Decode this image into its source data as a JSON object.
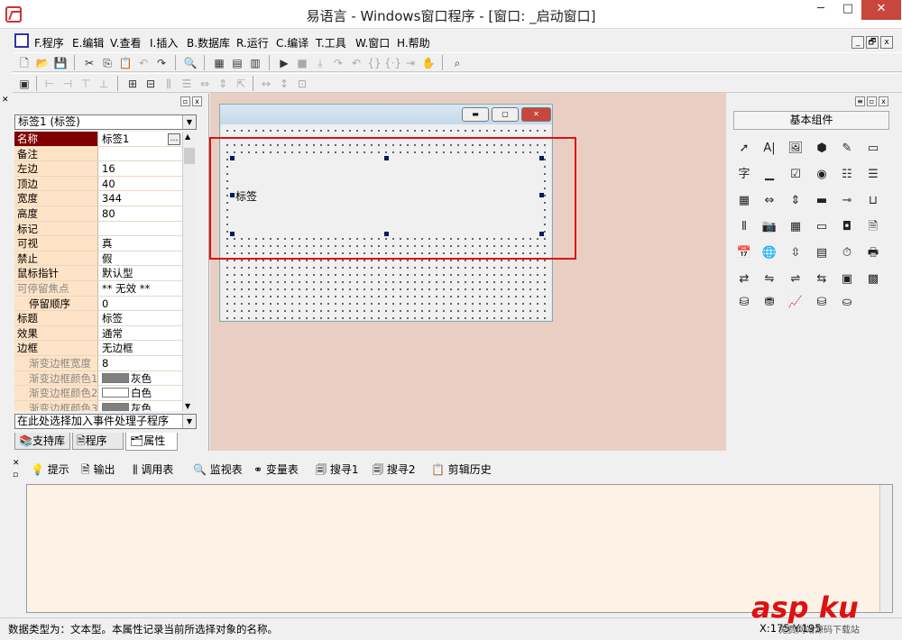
{
  "window": {
    "title": "易语言 - Windows窗口程序 - [窗口: _启动窗口]",
    "min": "─",
    "max": "□",
    "close": "✕"
  },
  "menu": {
    "items": [
      "F.程序",
      "E.编辑",
      "V.查看",
      "I.插入",
      "B.数据库",
      "R.运行",
      "C.编译",
      "T.工具",
      "W.窗口",
      "H.帮助"
    ],
    "mdi": [
      "_",
      "🗗",
      "x"
    ]
  },
  "left_panel": {
    "object_select": "标签1 (标签)",
    "properties": [
      {
        "name": "名称",
        "value": "标签1",
        "selected": true
      },
      {
        "name": "备注",
        "value": ""
      },
      {
        "name": "左边",
        "value": "16"
      },
      {
        "name": "顶边",
        "value": "40"
      },
      {
        "name": "宽度",
        "value": "344"
      },
      {
        "name": "高度",
        "value": "80"
      },
      {
        "name": "标记",
        "value": ""
      },
      {
        "name": "可视",
        "value": "真"
      },
      {
        "name": "禁止",
        "value": "假"
      },
      {
        "name": "鼠标指针",
        "value": "默认型"
      },
      {
        "name": "可停留焦点",
        "value": "** 无效 **",
        "disabled": true
      },
      {
        "name": "停留顺序",
        "value": "0",
        "indent": true
      },
      {
        "name": "标题",
        "value": "标签"
      },
      {
        "name": "效果",
        "value": "通常"
      },
      {
        "name": "边框",
        "value": "无边框"
      },
      {
        "name": "渐变边框宽度",
        "value": "8",
        "indent": true,
        "disabled": true
      },
      {
        "name": "渐变边框颜色1",
        "value": "灰色",
        "indent": true,
        "disabled": true,
        "swatch": "#808080"
      },
      {
        "name": "渐变边框颜色2",
        "value": "白色",
        "indent": true,
        "disabled": true,
        "swatch": "#ffffff"
      },
      {
        "name": "渐变边框颜色3",
        "value": "灰色",
        "indent": true,
        "disabled": true,
        "swatch": "#808080"
      }
    ],
    "event_select": "在此处选择加入事件处理子程序",
    "tabs": [
      "支持库",
      "程序",
      "属性"
    ]
  },
  "designer": {
    "label_text": "标签"
  },
  "right_panel": {
    "title": "基本组件"
  },
  "bottom": {
    "tabs": [
      "提示",
      "输出",
      "调用表",
      "监视表",
      "变量表",
      "搜寻1",
      "搜寻2",
      "剪辑历史"
    ]
  },
  "status": {
    "text": "数据类型为：文本型。本属性记录当前所选择对象的名称。",
    "coords": "X:175  Y:195"
  },
  "watermark": {
    "text": "asp ku",
    "sub": "免费网站源码下载站"
  },
  "colors": {
    "selected_prop": "#7f0000",
    "prop_bg": "#ffe3c6",
    "designer_bg": "#e9cfc3",
    "highlight_box": "#dd1111",
    "output_bg": "#fdf2e6"
  }
}
